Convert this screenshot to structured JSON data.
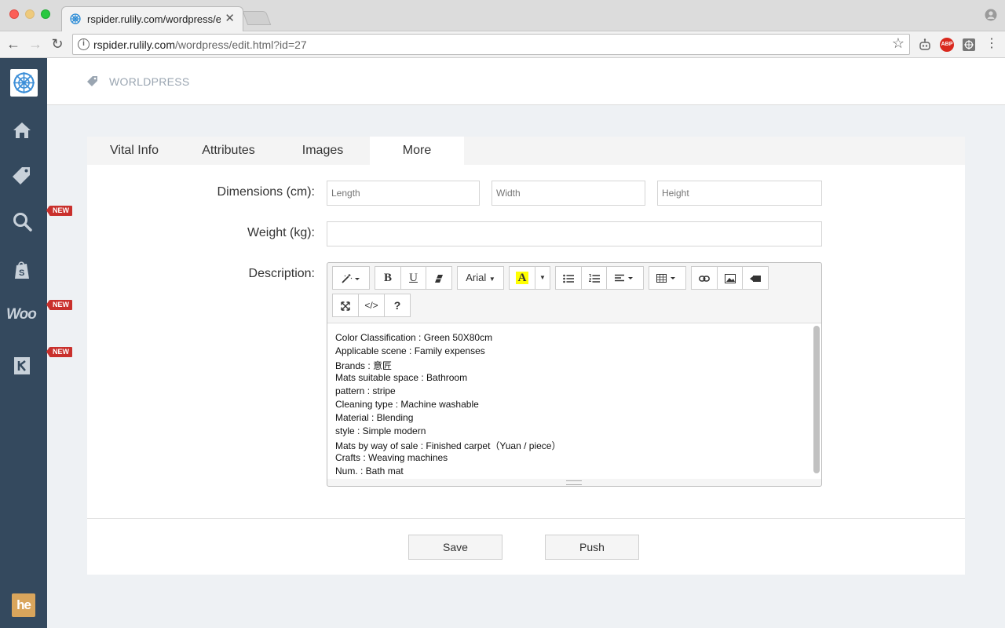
{
  "browser": {
    "tab_title": "rspider.rulily.com/wordpress/e",
    "tab_close": "✕",
    "url_host": "rspider.rulily.com",
    "url_path": "/wordpress/edit.html?id=27",
    "info_glyph": "i",
    "star_glyph": "☆",
    "back_glyph": "←",
    "forward_glyph": "→",
    "reload_glyph": "↻",
    "extensions": [
      "robot-icon",
      "adblock-icon",
      "settings-ext-icon"
    ],
    "abp_text": "ABP"
  },
  "sidebar": {
    "items": [
      "home-icon",
      "tag-icon",
      "search-icon",
      "shopify-icon",
      "woo-icon",
      "r-icon"
    ],
    "woo_text": "Woo",
    "new_badges": [
      "NEW",
      "NEW",
      "NEW"
    ],
    "he_text": "he"
  },
  "header": {
    "title": "WORLDPRESS"
  },
  "tabs": [
    "Vital Info",
    "Attributes",
    "Images",
    "More"
  ],
  "active_tab": "More",
  "form": {
    "dimensions_label": "Dimensions (cm):",
    "length_placeholder": "Length",
    "width_placeholder": "Width",
    "height_placeholder": "Height",
    "weight_label": "Weight (kg):",
    "weight_value": "",
    "description_label": "Description:"
  },
  "editor": {
    "font_name": "Arial",
    "bold": "B",
    "underline": "U",
    "help": "?",
    "code": "</>",
    "highlight": "A",
    "lines": [
      "Color Classification : Green 50X80cm",
      "Applicable scene : Family expenses",
      "Brands : 意匠",
      "Mats suitable space : Bathroom",
      "pattern : stripe",
      "Cleaning type : Machine washable",
      "Material : Blending",
      "style : Simple modern",
      "Mats by way of sale : Finished carpet（Yuan / piece）",
      "Crafts : Weaving machines",
      "Num. : Bath mat"
    ]
  },
  "actions": {
    "save": "Save",
    "push": "Push"
  },
  "colors": {
    "sidebar": "#34495e",
    "badge": "#c9302c",
    "he_logo": "#d9a55c",
    "highlight": "#ffff00"
  }
}
